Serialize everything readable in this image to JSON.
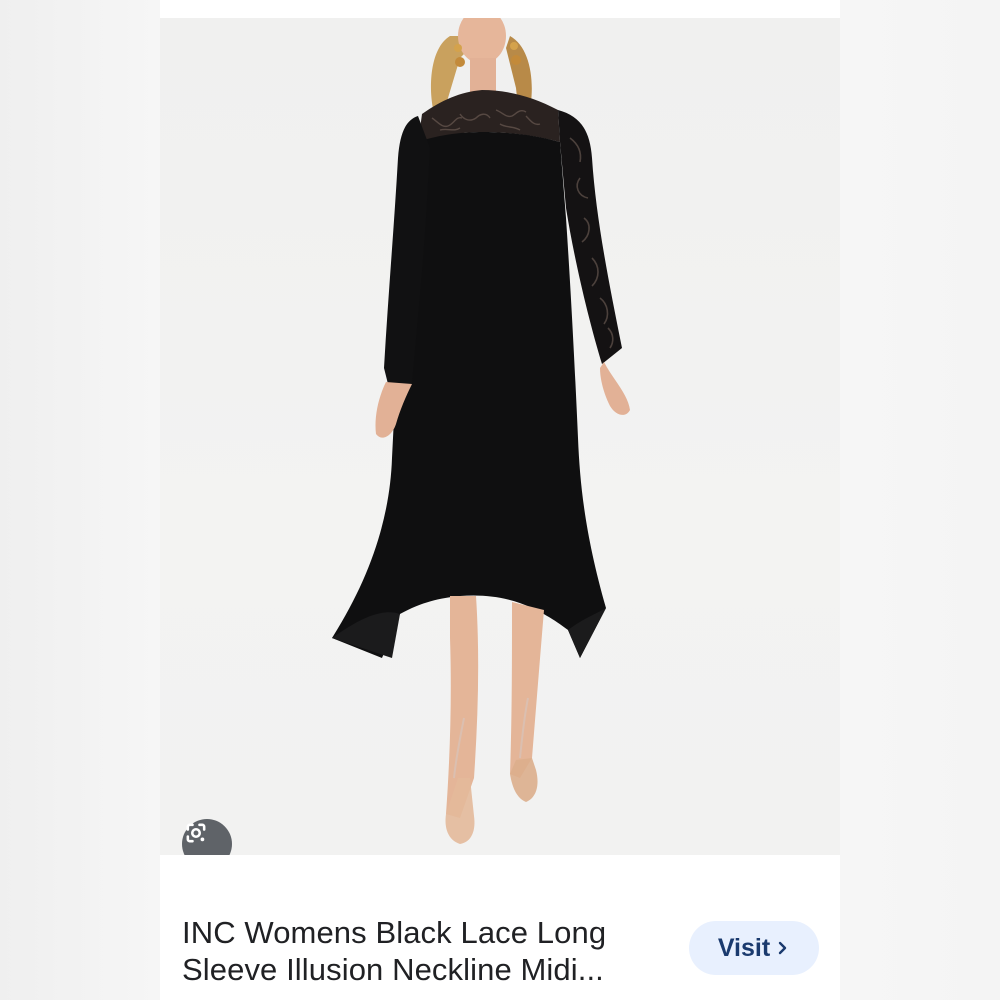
{
  "image_card": {
    "product_image_alt": "Black long sleeve midi dress with lace sleeve and illusion neckline",
    "lens_button_icon": "google-lens-icon",
    "title_lines": [
      "INC Womens Black Lace Long",
      "Sleeve Illusion Neckline Midi..."
    ],
    "visit_label": "Visit",
    "visit_icon": "chevron-right-icon"
  },
  "colors": {
    "visit_bg": "#e8f0fe",
    "visit_text": "#1a3a6e",
    "lens_bg": "#5f6368",
    "title_text": "#202124"
  }
}
